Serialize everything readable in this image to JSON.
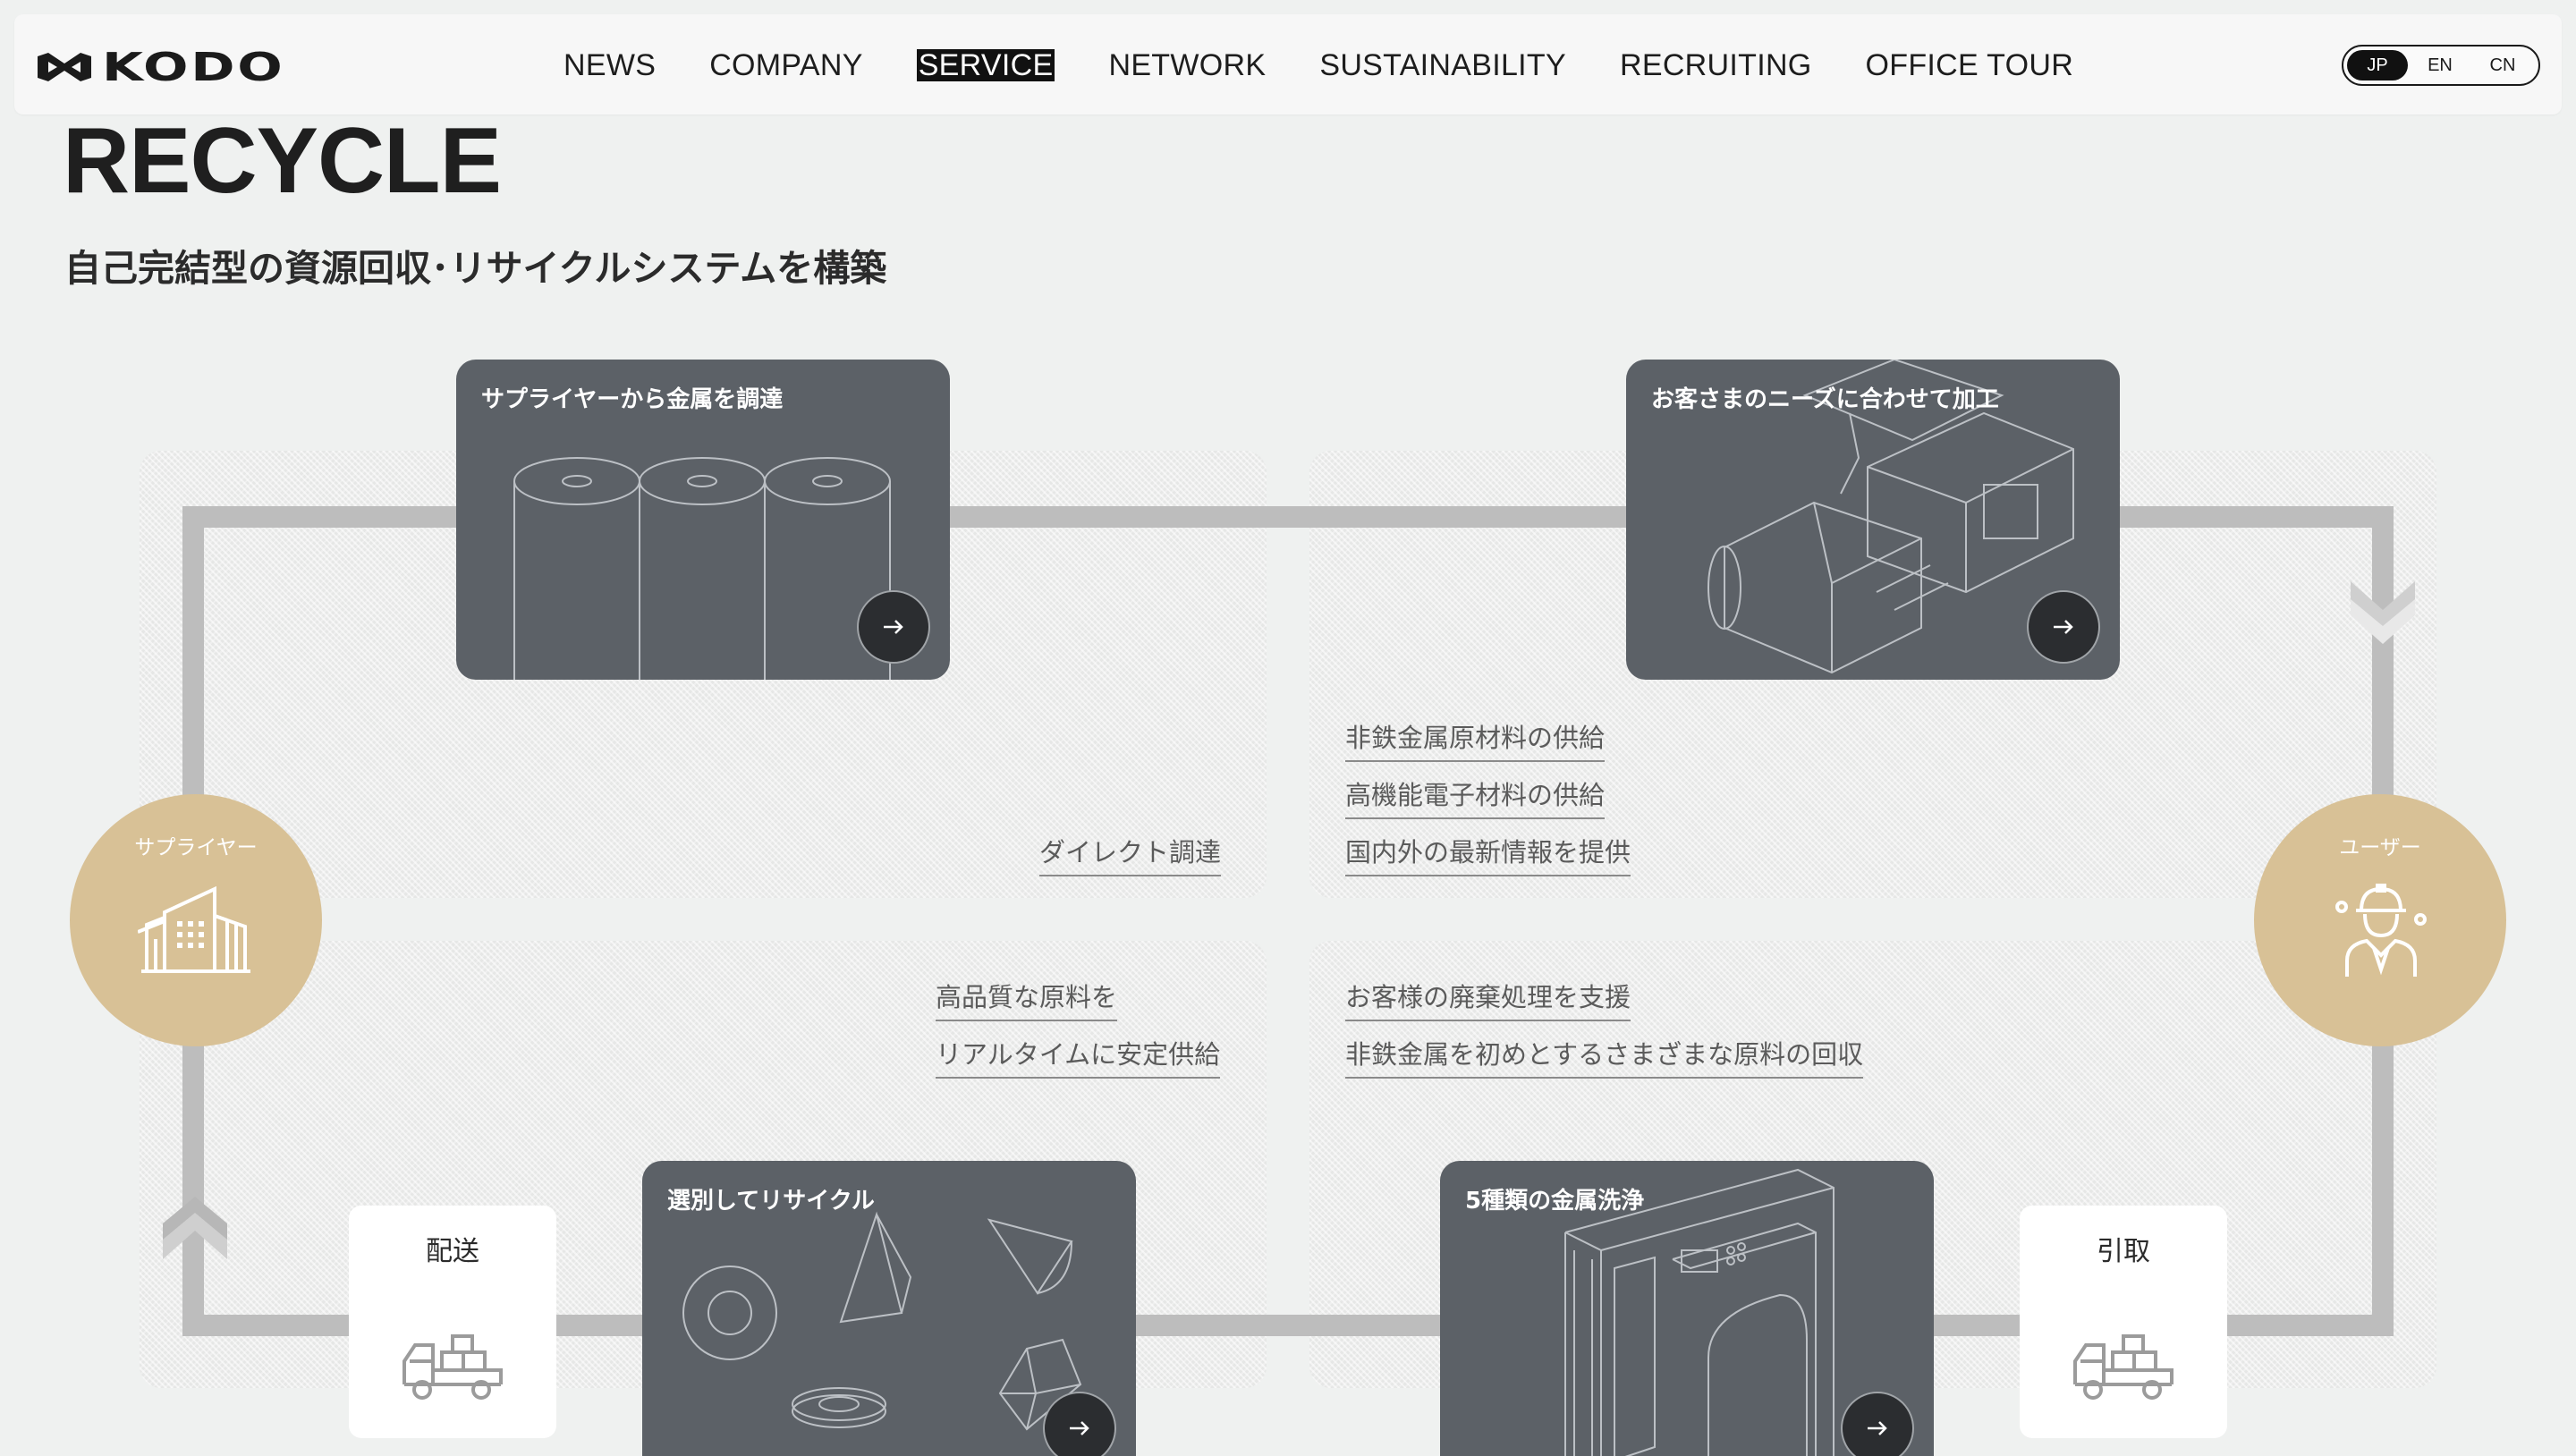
{
  "header": {
    "logo_text": "KODO",
    "nav": [
      "NEWS",
      "COMPANY",
      "SERVICE",
      "NETWORK",
      "SUSTAINABILITY",
      "RECRUITING",
      "OFFICE TOUR"
    ],
    "active_nav": "SERVICE",
    "languages": [
      "JP",
      "EN",
      "CN"
    ],
    "active_language": "JP"
  },
  "page": {
    "title": "RECYCLE",
    "subtitle": "自己完結型の資源回収･リサイクルシステムを構築"
  },
  "diagram": {
    "supplier_label": "サプライヤー",
    "user_label": "ユーザー",
    "delivery_label": "配送",
    "pickup_label": "引取",
    "cards": {
      "procure": "サプライヤーから金属を調達",
      "process": "お客さまのニーズに合わせて加工",
      "sort": "選別してリサイクル",
      "wash": "5種類の金属洗浄"
    },
    "links": {
      "direct": "ダイレクト調達",
      "nonferrous_supply": "非鉄金属原材料の供給",
      "electronic_supply": "高機能電子材料の供給",
      "info": "国内外の最新情報を提供",
      "quality_1": "高品質な原料を",
      "quality_2": "リアルタイムに安定供給",
      "waste_support": "お客様の廃棄処理を支援",
      "collection": "非鉄金属を初めとするさまざまな原料の回収"
    },
    "colors": {
      "card": "#5c6167",
      "circle": "#d8c196",
      "track": "#bdbdbd"
    }
  }
}
